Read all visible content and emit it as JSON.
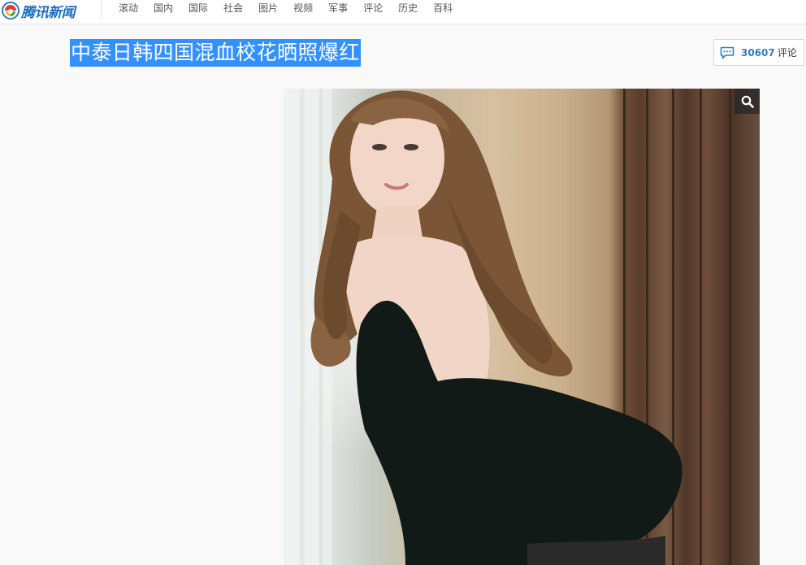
{
  "header": {
    "logo_text": "腾讯新闻",
    "nav": [
      "滚动",
      "国内",
      "国际",
      "社会",
      "图片",
      "视频",
      "军事",
      "评论",
      "历史",
      "百科"
    ]
  },
  "article": {
    "title": "中泰日韩四国混血校花晒照爆红"
  },
  "comments": {
    "count": "30607",
    "label": "评论"
  },
  "photo": {
    "zoom_icon": "search-icon"
  },
  "colors": {
    "selection": "#3390ff",
    "brand_blue": "#1a6cc4",
    "comment_count": "#2d7fc6"
  }
}
